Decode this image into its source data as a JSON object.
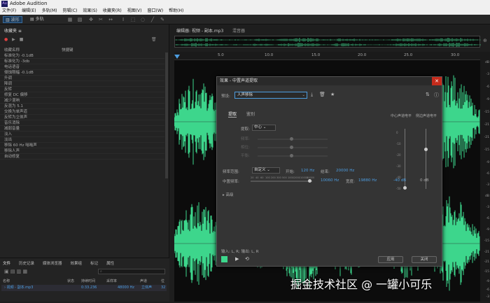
{
  "window": {
    "title": "Adobe Audition",
    "logo": "Au"
  },
  "menu": [
    "文件(F)",
    "编辑(E)",
    "多轨(M)",
    "剪辑(C)",
    "效果(S)",
    "收藏夹(R)",
    "视图(V)",
    "窗口(W)",
    "帮助(H)"
  ],
  "toolbar": {
    "waveform": "波形",
    "multitrack": "多轨"
  },
  "left_panel": {
    "tab": "收藏夹",
    "col_name": "收藏名称",
    "col_shortcut": "快捷键",
    "items": [
      "标准化为 -0.1dB",
      "标准化为 -3db",
      "电话语音",
      "侵蚀限幅 -0.1dB",
      "升调",
      "降调",
      "反转",
      "修复 DC 偏移",
      "减少混响",
      "反混为 5.1",
      "交换为单声道",
      "反转为立体声",
      "音乐消除",
      "减弱音量",
      "淡入",
      "淡出",
      "移除 60 Hz 嗡嗡声",
      "移除人声",
      "自动修复"
    ]
  },
  "files_panel": {
    "tabs": [
      "文件",
      "历史记录",
      "媒体浏览器",
      "效果组",
      "标记",
      "属性"
    ],
    "headers": [
      "名称",
      "状态",
      "持续时间",
      "采样率",
      "声道",
      "位"
    ],
    "row": {
      "name": "视频 - 副本.mp3",
      "duration": "0:33.236",
      "sample_rate": "48000 Hz",
      "channels": "立体声",
      "bits": "32"
    }
  },
  "editor": {
    "tab": "编辑器: 视频 - 副本.mp3",
    "mixer": "混音器",
    "ruler": [
      "5.0",
      "10.0",
      "15.0",
      "20.0",
      "25.0",
      "30.0"
    ],
    "right_ruler": [
      "dB",
      "-3",
      "-6",
      "-9",
      "-15",
      "-21",
      "-21",
      "-15",
      "-9",
      "-6",
      "-3",
      "dB",
      "-3",
      "-6",
      "-9",
      "-15",
      "-21",
      "-21",
      "-15",
      "-9",
      "-6",
      "-3"
    ]
  },
  "dialog": {
    "title": "效果 - 中置声道提取",
    "preset_label": "预设:",
    "preset": "人声移除",
    "tab_extract": "提取",
    "tab_distinguish": "鉴别",
    "extract_label": "提取:",
    "extract_value": "中心",
    "faint_rows": [
      "频率:",
      "相位:",
      "平衡:"
    ],
    "freq_range_label": "频率范围:",
    "freq_range": "自定义",
    "start_label": "开始:",
    "start_value": "120 Hz",
    "end_label": "结束:",
    "end_value": "20000 Hz",
    "center_freq_label": "中置频率:",
    "center_freq_value": "10060 Hz",
    "width_label": "宽度:",
    "width_value": "19880 Hz",
    "scale_ticks": [
      "20",
      "40",
      "60",
      "100",
      "200",
      "300",
      "500",
      "1000",
      "2000",
      "10000",
      "20000"
    ],
    "meter_center_title": "中心声道电平",
    "meter_side_title": "侧边声道电平",
    "meter_center_value": "-40 dB",
    "meter_side_value": "0 dB",
    "meter_ticks": [
      "0",
      "-10",
      "-20",
      "-30",
      "-40",
      "-50"
    ],
    "advanced": "高级",
    "io_label": "输入: L, R;  输出: L, R",
    "apply": "应用",
    "close": "关闭"
  },
  "watermark": "掘金技术社区 @ 一罐小可乐",
  "colors": {
    "wave": "#3dd68c",
    "accent": "#4d9de0",
    "close": "#c42b1c"
  }
}
